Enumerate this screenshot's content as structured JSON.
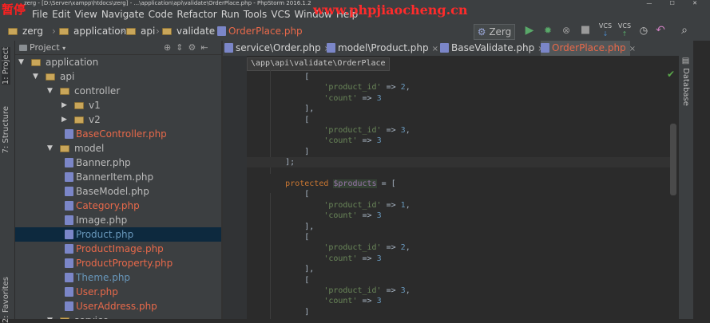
{
  "window": {
    "title": "zerg - [D:\\Server\\xampp\\htdocs\\zerg] - ...\\application\\api\\validate\\OrderPlace.php - PhpStorm 2016.1.2",
    "controls": "— ☐ ✕"
  },
  "overlay": {
    "pause_label": "暂停",
    "watermark": "www.phpjiaocheng.cn"
  },
  "menu": [
    "File",
    "Edit",
    "View",
    "Navigate",
    "Code",
    "Refactor",
    "Run",
    "Tools",
    "VCS",
    "Window",
    "Help"
  ],
  "navbar": {
    "crumbs": [
      "zerg",
      "application",
      "api",
      "validate"
    ],
    "file": "OrderPlace.php",
    "run_config": "Zerg"
  },
  "sidebar_tabs": {
    "project": "1: Project",
    "structure": "7: Structure",
    "favorites": "2: Favorites",
    "database": "Database"
  },
  "project_panel": {
    "label": "Project",
    "tree": [
      {
        "name": "application",
        "type": "folder",
        "open": true,
        "level": 1,
        "color": "#bbbbbb"
      },
      {
        "name": "api",
        "type": "folder",
        "open": true,
        "level": 2,
        "color": "#bbbbbb"
      },
      {
        "name": "controller",
        "type": "folder",
        "open": true,
        "level": 3,
        "color": "#bbbbbb"
      },
      {
        "name": "v1",
        "type": "folder",
        "open": false,
        "level": 4,
        "color": "#bbbbbb"
      },
      {
        "name": "v2",
        "type": "folder",
        "open": false,
        "level": 4,
        "color": "#bbbbbb"
      },
      {
        "name": "BaseController.php",
        "type": "file",
        "level": 4,
        "color": "#e8694a"
      },
      {
        "name": "model",
        "type": "folder",
        "open": true,
        "level": 3,
        "color": "#bbbbbb"
      },
      {
        "name": "Banner.php",
        "type": "file",
        "level": 4,
        "color": "#bbbbbb"
      },
      {
        "name": "BannerItem.php",
        "type": "file",
        "level": 4,
        "color": "#bbbbbb"
      },
      {
        "name": "BaseModel.php",
        "type": "file",
        "level": 4,
        "color": "#bbbbbb"
      },
      {
        "name": "Category.php",
        "type": "file",
        "level": 4,
        "color": "#e8694a"
      },
      {
        "name": "Image.php",
        "type": "file",
        "level": 4,
        "color": "#bbbbbb"
      },
      {
        "name": "Product.php",
        "type": "file",
        "level": 4,
        "color": "#6897bb",
        "selected": true
      },
      {
        "name": "ProductImage.php",
        "type": "file",
        "level": 4,
        "color": "#e8694a"
      },
      {
        "name": "ProductProperty.php",
        "type": "file",
        "level": 4,
        "color": "#e8694a"
      },
      {
        "name": "Theme.php",
        "type": "file",
        "level": 4,
        "color": "#6897bb"
      },
      {
        "name": "User.php",
        "type": "file",
        "level": 4,
        "color": "#e8694a"
      },
      {
        "name": "UserAddress.php",
        "type": "file",
        "level": 4,
        "color": "#e8694a"
      },
      {
        "name": "service",
        "type": "folder",
        "open": true,
        "level": 3,
        "color": "#bbbbbb"
      }
    ]
  },
  "tabs": [
    {
      "label": "service\\Order.php",
      "active": false
    },
    {
      "label": "model\\Product.php",
      "active": false
    },
    {
      "label": "BaseValidate.php",
      "active": false
    },
    {
      "label": "OrderPlace.php",
      "active": true
    }
  ],
  "editor": {
    "breadcrumb": "\\app\\api\\validate\\OrderPlace",
    "lines": [
      [
        [
          "            [",
          ""
        ]
      ],
      [
        [
          "                ",
          ""
        ],
        [
          "'product_id'",
          "str"
        ],
        [
          " => ",
          ""
        ],
        [
          "2",
          "num"
        ],
        [
          ",",
          ""
        ]
      ],
      [
        [
          "                ",
          ""
        ],
        [
          "'count'",
          "str"
        ],
        [
          " => ",
          ""
        ],
        [
          "3",
          "num"
        ]
      ],
      [
        [
          "            ],",
          ""
        ]
      ],
      [
        [
          "            [",
          ""
        ]
      ],
      [
        [
          "                ",
          ""
        ],
        [
          "'product_id'",
          "str"
        ],
        [
          " => ",
          ""
        ],
        [
          "3",
          "num"
        ],
        [
          ",",
          ""
        ]
      ],
      [
        [
          "                ",
          ""
        ],
        [
          "'count'",
          "str"
        ],
        [
          " => ",
          ""
        ],
        [
          "3",
          "num"
        ]
      ],
      [
        [
          "            ]",
          ""
        ]
      ],
      [
        [
          "        ];",
          ""
        ]
      ],
      [
        [
          "",
          ""
        ]
      ],
      [
        [
          "        ",
          ""
        ],
        [
          "protected",
          "kw"
        ],
        [
          " ",
          ""
        ],
        [
          "$products",
          "var"
        ],
        [
          " = [",
          ""
        ]
      ],
      [
        [
          "            [",
          ""
        ]
      ],
      [
        [
          "                ",
          ""
        ],
        [
          "'product_id'",
          "str"
        ],
        [
          " => ",
          ""
        ],
        [
          "1",
          "num"
        ],
        [
          ",",
          ""
        ]
      ],
      [
        [
          "                ",
          ""
        ],
        [
          "'count'",
          "str"
        ],
        [
          " => ",
          ""
        ],
        [
          "3",
          "num"
        ]
      ],
      [
        [
          "            ],",
          ""
        ]
      ],
      [
        [
          "            [",
          ""
        ]
      ],
      [
        [
          "                ",
          ""
        ],
        [
          "'product_id'",
          "str"
        ],
        [
          " => ",
          ""
        ],
        [
          "2",
          "num"
        ],
        [
          ",",
          ""
        ]
      ],
      [
        [
          "                ",
          ""
        ],
        [
          "'count'",
          "str"
        ],
        [
          " => ",
          ""
        ],
        [
          "3",
          "num"
        ]
      ],
      [
        [
          "            ],",
          ""
        ]
      ],
      [
        [
          "            [",
          ""
        ]
      ],
      [
        [
          "                ",
          ""
        ],
        [
          "'product_id'",
          "str"
        ],
        [
          " => ",
          ""
        ],
        [
          "3",
          "num"
        ],
        [
          ",",
          ""
        ]
      ],
      [
        [
          "                ",
          ""
        ],
        [
          "'count'",
          "str"
        ],
        [
          " => ",
          ""
        ],
        [
          "3",
          "num"
        ]
      ],
      [
        [
          "            ]",
          ""
        ]
      ]
    ]
  },
  "icons": {
    "run": "play-icon",
    "debug": "bug-icon",
    "coverage": "coverage-icon",
    "vcs_update": "vcs-update-icon",
    "vcs_commit": "vcs-commit-icon",
    "history": "history-icon",
    "revert": "revert-icon",
    "search": "search-icon",
    "check": "check-icon",
    "settings": "gear-icon",
    "hide": "hide-icon",
    "target": "target-icon"
  },
  "colors": {
    "accent": "#e8694a",
    "selection": "#0d293e",
    "string": "#6a8759",
    "number": "#6897bb",
    "keyword": "#cc7832",
    "field": "#9876aa"
  }
}
